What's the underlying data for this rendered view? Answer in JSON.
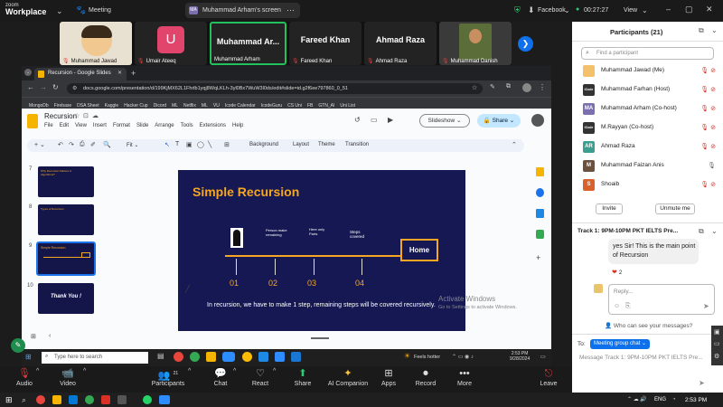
{
  "zoom": {
    "brand_small": "zoom",
    "brand_big": "Workplace",
    "meeting_label": "Meeting",
    "share_badge": "MA",
    "share_text": "Muhammad Arham's screen",
    "facebook": "Facebook",
    "timer": "00:27:27",
    "view": "View"
  },
  "video_tiles": [
    {
      "name": "Muhammad Jawad"
    },
    {
      "name": "Umair Ateeq",
      "initial": "U"
    },
    {
      "big": "Muhammad  Ar...",
      "name": "Muhammad Arham"
    },
    {
      "big": "Fareed Khan",
      "name": "Fareed Khan"
    },
    {
      "big": "Ahmad Raza",
      "name": "Ahmad Raza"
    },
    {
      "name": "Muhammad Danish"
    }
  ],
  "browser": {
    "tab_title": "Recursion - Google Slides",
    "url": "docs.google.com/presentation/d/199KjMX62L1Fhrlb1yqj8WqLKLh-3yl0Bx7WuW3l0ds/edit#slide=id.g2f6ee797860_0_51",
    "bookmarks": [
      "MongoDb",
      "Firebase",
      "DSA Sheet",
      "Kaggle",
      "Hacker Cup",
      "Dicord",
      "ML",
      "Netflix",
      "ML",
      "VU",
      "Icode Calendar",
      "IcodeGuru",
      "CS Uni",
      "FB",
      "GTN_AI",
      "Uni List"
    ]
  },
  "slides": {
    "doc_title": "Recursion",
    "menus": [
      "File",
      "Edit",
      "View",
      "Insert",
      "Format",
      "Slide",
      "Arrange",
      "Tools",
      "Extensions",
      "Help"
    ],
    "slideshow_label": "Slideshow",
    "share_label": "Share",
    "toolbar": {
      "zoom": "Fit",
      "background": "Background",
      "layout": "Layout",
      "theme": "Theme",
      "transition": "Transition"
    },
    "thumbs": [
      {
        "num": "7",
        "title": "Why Recursion Matters in Algorithms?"
      },
      {
        "num": "8",
        "title": "Types of Recursion"
      },
      {
        "num": "9",
        "title": "Simple Recursion"
      },
      {
        "num": "10",
        "title": "Thank You !"
      }
    ],
    "slide": {
      "title": "Simple Recursion",
      "labels": [
        "Person make remaining",
        "Here only Parts",
        "Steps covered"
      ],
      "home": "Home",
      "steps": [
        "01",
        "02",
        "03",
        "04"
      ],
      "body": "In recursion, we have to make 1 step, remaining steps will be covered recursively."
    },
    "activate_title": "Activate Windows",
    "activate_sub": "Go to Settings to activate Windows."
  },
  "inner_taskbar": {
    "search": "Type here to search",
    "weather": "Feels hotter",
    "time": "2:53 PM",
    "date": "9/28/2024"
  },
  "controls": [
    {
      "label": "Audio",
      "icon": "🎙"
    },
    {
      "label": "Video",
      "icon": "📹"
    },
    {
      "label": "Participants",
      "icon": "👥",
      "count": "21"
    },
    {
      "label": "Chat",
      "icon": "💬"
    },
    {
      "label": "React",
      "icon": "♡"
    },
    {
      "label": "Share",
      "icon": "⬆"
    },
    {
      "label": "AI Companion",
      "icon": "✦"
    },
    {
      "label": "Apps",
      "icon": "⊞"
    },
    {
      "label": "Record",
      "icon": "⏺"
    },
    {
      "label": "More",
      "icon": "•••"
    },
    {
      "label": "Leave",
      "icon": "⎋"
    }
  ],
  "panel": {
    "title": "Participants (21)",
    "search_placeholder": "Find a participant",
    "participants": [
      {
        "name": "Muhammad Jawad (Me)",
        "avatar": "",
        "color": "#f3c16a"
      },
      {
        "name": "Muhammad Farhan (Host)",
        "avatar": "iCode",
        "color": "#333333"
      },
      {
        "name": "Muhammad Arham (Co-host)",
        "avatar": "MA",
        "color": "#7b6fb0"
      },
      {
        "name": "M.Rayyan (Co-host)",
        "avatar": "iCode",
        "color": "#333333"
      },
      {
        "name": "Ahmad Raza",
        "avatar": "AR",
        "color": "#3c9e8f"
      },
      {
        "name": "Muhammad Faizan Anis",
        "avatar": "M",
        "color": "#6b4f3f"
      },
      {
        "name": "Shoaib",
        "avatar": "S",
        "color": "#d9622b"
      }
    ],
    "invite": "Invite",
    "unmute_all": "Unmute me",
    "chat_title": "Track 1: 9PM-10PM PKT IELTS Pre...",
    "chat_message": "yes Sir! This is the main point of Recursion",
    "reaction_count": "2",
    "reply_placeholder": "Reply...",
    "who_can_see": "Who can see your messages?",
    "to_label": "To:",
    "to_target": "Meeting group chat",
    "message_placeholder": "Message Track 1: 9PM-10PM PKT IELTS Pre..."
  },
  "windows": {
    "lang": "ENG",
    "time": "2:53 PM"
  }
}
